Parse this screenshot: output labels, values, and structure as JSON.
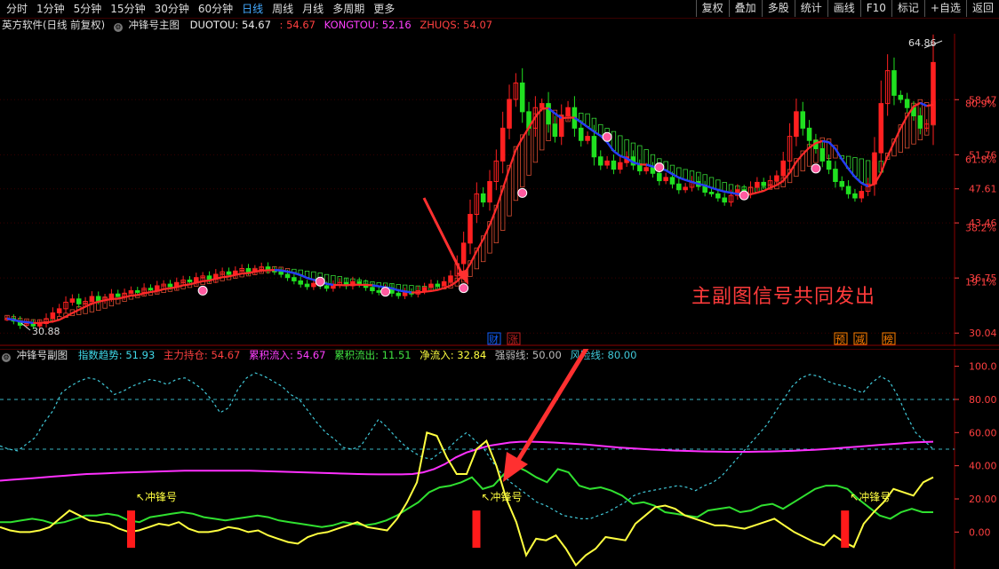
{
  "toolbar": {
    "periods": [
      "分时",
      "1分钟",
      "5分钟",
      "15分钟",
      "30分钟",
      "60分钟",
      "日线",
      "周线",
      "月线",
      "多周期",
      "更多"
    ],
    "active_period": "日线",
    "right_buttons": [
      "复权",
      "叠加",
      "多股",
      "统计",
      "画线",
      "F10",
      "标记",
      "+自选",
      "返回"
    ]
  },
  "main_header": {
    "app": "英方软件(日线 前复权)",
    "indicator": "冲锋号主图",
    "duotou": "DUOTOU: 54.67",
    "duotou2": ": 54.67",
    "kongtou": "KONGTOU: 52.16",
    "zhuqs": "ZHUQS: 54.07"
  },
  "sub_header": {
    "indicator": "冲锋号副图",
    "zhishu": "指数趋势: 51.93",
    "zhuli": "主力持仓: 54.67",
    "leiji_in": "累积流入: 54.67",
    "leiji_out": "累积流出: 11.51",
    "jing": "净流入: 32.84",
    "qiang": "强弱线: 50.00",
    "fengxian": "风险线: 80.00"
  },
  "annotation": "主副图信号共同发出",
  "main_markers": {
    "high": "64.86",
    "low": "30.88",
    "cai": "财",
    "zhang": "涨",
    "yu": "预",
    "jian": "减",
    "bang": "榜"
  },
  "signal_label": "冲锋号",
  "colors": {
    "bg": "#000000",
    "up": "#ff2020",
    "down": "#20e020",
    "axis": "#8a0000",
    "magenta": "#ff30ff",
    "yellow": "#ffff40",
    "green": "#30e030",
    "cyan": "#40c8d8",
    "ma_red": "#ff2a2a",
    "ma_blue": "#2040ff"
  },
  "chart_data": [
    {
      "type": "candlestick",
      "title": "冲锋号主图",
      "ylim": [
        30.04,
        64.86
      ],
      "price_ticks": [
        "58.47",
        "51.76",
        "47.61",
        "43.46",
        "36.75",
        "30.04"
      ],
      "pct_ticks": [
        "80.9%",
        "61.8%",
        "38.2%",
        "19.1%"
      ],
      "pct_tick_prices": [
        58.0,
        51.2,
        42.9,
        36.3
      ],
      "closes": [
        31.8,
        31.5,
        31.0,
        31.2,
        30.9,
        31.2,
        31.8,
        32.5,
        33.0,
        33.8,
        34.2,
        33.6,
        33.9,
        34.5,
        34.0,
        34.3,
        34.8,
        34.5,
        34.9,
        35.2,
        35.0,
        35.5,
        35.3,
        35.8,
        36.0,
        35.7,
        36.2,
        36.5,
        36.3,
        36.8,
        37.0,
        36.6,
        37.2,
        37.5,
        37.2,
        37.6,
        37.9,
        37.5,
        37.8,
        38.1,
        37.7,
        37.5,
        37.2,
        36.8,
        36.4,
        36.0,
        35.7,
        36.1,
        35.8,
        35.5,
        35.9,
        36.2,
        35.8,
        36.3,
        36.0,
        35.6,
        35.2,
        35.0,
        35.4,
        34.9,
        34.6,
        35.0,
        34.8,
        35.2,
        35.6,
        36.0,
        35.8,
        36.3,
        37.0,
        38.5,
        41.0,
        44.5,
        47.0,
        46.0,
        48.5,
        51.0,
        55.0,
        58.5,
        60.5,
        57.0,
        55.0,
        57.5,
        58.0,
        55.5,
        54.0,
        56.5,
        57.5,
        55.0,
        53.5,
        54.0,
        51.5,
        50.5,
        51.0,
        50.0,
        50.8,
        51.5,
        50.5,
        49.8,
        50.2,
        49.5,
        48.6,
        49.0,
        48.2,
        47.5,
        47.8,
        48.5,
        47.9,
        47.2,
        47.0,
        46.5,
        46.0,
        46.8,
        47.5,
        47.0,
        47.8,
        48.4,
        48.0,
        48.6,
        49.2,
        51.0,
        54.0,
        57.0,
        55.0,
        53.5,
        52.5,
        51.0,
        50.0,
        48.5,
        47.9,
        47.0,
        46.5,
        47.3,
        48.2,
        52.0,
        58.0,
        62.0,
        59.0,
        58.5,
        57.5,
        56.5,
        55.0,
        55.5,
        63.0
      ],
      "signals_up_at": [
        30,
        48,
        58,
        70,
        79,
        92,
        100,
        113,
        124
      ],
      "signals_down_at": []
    },
    {
      "type": "line",
      "title": "冲锋号副图",
      "ylim": [
        0,
        100
      ],
      "ticks": [
        "100.0",
        "80.00",
        "60.00",
        "40.00",
        "20.00",
        "0.00"
      ],
      "series": [
        {
          "name": "指数趋势",
          "color": "#40c8d8",
          "style": "dashed",
          "values": [
            52,
            50,
            49,
            53,
            57,
            66,
            73,
            84,
            88,
            91,
            93,
            92,
            88,
            83,
            85,
            88,
            90,
            92,
            91,
            89,
            92,
            93,
            90,
            86,
            80,
            72,
            75,
            86,
            93,
            96,
            94,
            91,
            88,
            83,
            80,
            73,
            66,
            60,
            56,
            51,
            50,
            52,
            60,
            68,
            63,
            57,
            52,
            48,
            45,
            44,
            48,
            51,
            56,
            60,
            55,
            50,
            42,
            35,
            30,
            26,
            22,
            18,
            16,
            13,
            10,
            9,
            8,
            8,
            10,
            12,
            15,
            18,
            22,
            24,
            25,
            26,
            27,
            28,
            27,
            25,
            28,
            30,
            34,
            40,
            46,
            52,
            58,
            64,
            72,
            80,
            88,
            93,
            95,
            94,
            91,
            89,
            88,
            86,
            84,
            90,
            94,
            91,
            82,
            70,
            60,
            55,
            50
          ]
        },
        {
          "name": "主力持仓",
          "color": "#ff30ff",
          "style": "solid",
          "values": [
            31,
            31.5,
            32,
            32.5,
            33,
            33.5,
            34,
            34.5,
            35,
            35.2,
            35.5,
            35.8,
            36,
            36.2,
            36.4,
            36.6,
            36.8,
            37,
            37,
            37,
            37,
            37,
            37,
            37,
            36.8,
            36.6,
            36.4,
            36.2,
            36,
            35.8,
            35.6,
            35.4,
            35.2,
            35,
            34.9,
            34.8,
            34.8,
            34.8,
            35,
            36,
            38,
            41,
            45,
            48,
            50,
            52,
            53,
            54,
            54.5,
            54.5,
            54.3,
            54,
            53.6,
            53.2,
            52.8,
            52.2,
            51.6,
            51,
            50.6,
            50.2,
            49.8,
            49.5,
            49.2,
            49,
            48.8,
            48.6,
            48.5,
            48.4,
            48.4,
            48.4,
            48.5,
            48.6,
            48.8,
            49,
            49.3,
            49.6,
            50,
            50.5,
            51,
            51.5,
            52,
            52.5,
            53,
            53.5,
            54,
            54.3,
            54.5
          ]
        },
        {
          "name": "累积流入",
          "color": "#30e030",
          "style": "solid",
          "values": [
            6,
            6,
            7,
            8,
            7,
            5,
            6,
            8,
            10,
            10,
            11,
            10,
            7,
            6,
            9,
            10,
            11,
            12,
            11,
            9,
            8,
            7,
            8,
            9,
            10,
            9,
            7,
            6,
            5,
            4,
            3,
            4,
            6,
            5,
            4,
            5,
            7,
            10,
            14,
            18,
            24,
            27,
            28,
            30,
            33,
            26,
            28,
            35,
            40,
            37,
            33,
            30,
            38,
            36,
            28,
            26,
            27,
            25,
            22,
            17,
            18,
            16,
            12,
            11,
            10,
            9,
            13,
            14,
            15,
            12,
            13,
            16,
            17,
            14,
            18,
            22,
            26,
            28,
            28,
            26,
            20,
            15,
            10,
            8,
            12,
            14,
            12,
            12
          ]
        },
        {
          "name": "累积流出",
          "color": "#ffff40",
          "style": "solid",
          "values": [
            3,
            1,
            0,
            0,
            1,
            3,
            8,
            13,
            10,
            7,
            6,
            5,
            2,
            0,
            1,
            3,
            5,
            4,
            6,
            2,
            0,
            0,
            1,
            3,
            2,
            0,
            1,
            -2,
            -4,
            -6,
            -7,
            -3,
            -1,
            0,
            2,
            4,
            6,
            3,
            2,
            1,
            8,
            18,
            30,
            60,
            58,
            45,
            35,
            35,
            50,
            55,
            40,
            20,
            6,
            -14,
            -4,
            -5,
            -2,
            -10,
            -20,
            -14,
            -10,
            -3,
            -4,
            -5,
            5,
            10,
            15,
            16,
            14,
            10,
            8,
            6,
            4,
            4,
            3,
            2,
            4,
            6,
            8,
            4,
            0,
            -3,
            -6,
            -8,
            -2,
            -6,
            -9,
            5,
            12,
            18,
            26,
            24,
            22,
            30,
            33
          ]
        }
      ],
      "signal_bars_at": [
        0.14,
        0.51,
        0.905
      ]
    }
  ]
}
